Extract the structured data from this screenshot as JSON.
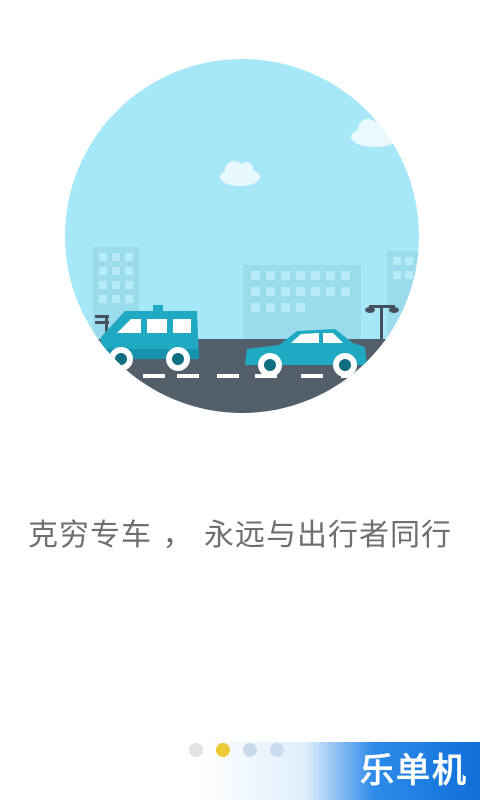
{
  "onboarding": {
    "tagline": "克穷专车 ， 永远与出行者同行",
    "illustration": "city-street-cars",
    "page_count": 4,
    "current_page": 2
  },
  "watermark": {
    "text": "乐单机"
  },
  "colors": {
    "sky": "#a6e8f7",
    "road": "#525f6b",
    "car_teal": "#20a9c3",
    "active_dot": "#f2c81a",
    "inactive_dot": "#e3e3e3",
    "tagline_text": "#6f6f6f",
    "watermark_blue": "#1d7fe3"
  }
}
